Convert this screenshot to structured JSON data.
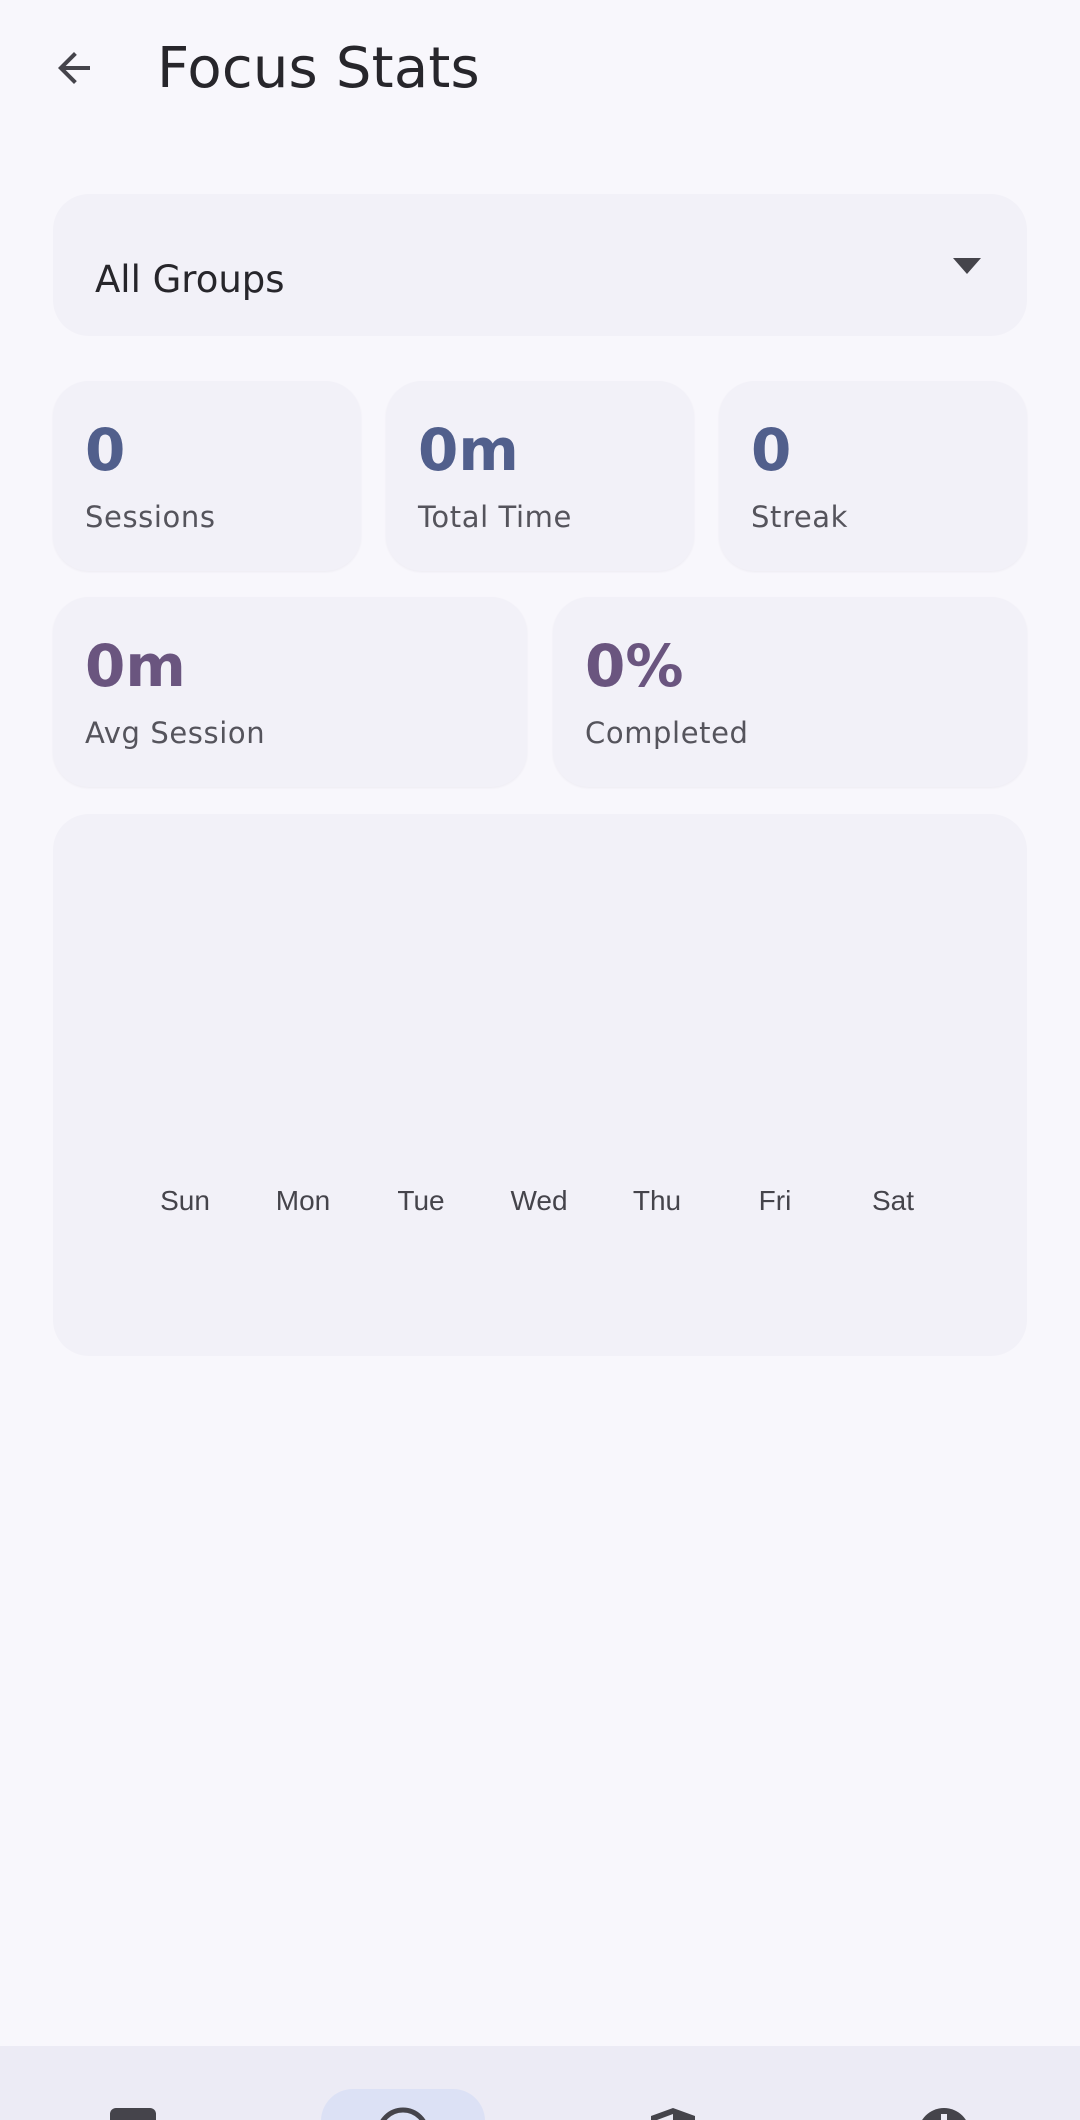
{
  "header": {
    "title": "Focus Stats",
    "back_icon": "arrow-back-icon"
  },
  "group_select": {
    "value": "All Groups",
    "icon": "dropdown-caret-icon"
  },
  "stats": {
    "sessions": {
      "value": "0",
      "label": "Sessions"
    },
    "total_time": {
      "value": "0m",
      "label": "Total Time"
    },
    "streak": {
      "value": "0",
      "label": "Streak"
    },
    "avg_session": {
      "value": "0m",
      "label": "Avg Session"
    },
    "completed": {
      "value": "0%",
      "label": "Completed"
    }
  },
  "colors": {
    "primary": "#515f8c",
    "tertiary": "#6a557f",
    "surface": "#f8f7fc",
    "card": "#f2f1f8",
    "nav_active": "#dce1f5"
  },
  "chart_data": {
    "type": "bar",
    "categories": [
      "Sun",
      "Mon",
      "Tue",
      "Wed",
      "Thu",
      "Fri",
      "Sat"
    ],
    "values": [
      0,
      0,
      0,
      0,
      0,
      0,
      0
    ],
    "title": "",
    "xlabel": "",
    "ylabel": "",
    "grid": false
  },
  "bottom_nav": {
    "items": [
      {
        "icon": "timer-icon",
        "active": false
      },
      {
        "icon": "stats-icon",
        "active": true
      },
      {
        "icon": "shield-icon",
        "active": false
      },
      {
        "icon": "info-icon",
        "active": false
      }
    ]
  }
}
